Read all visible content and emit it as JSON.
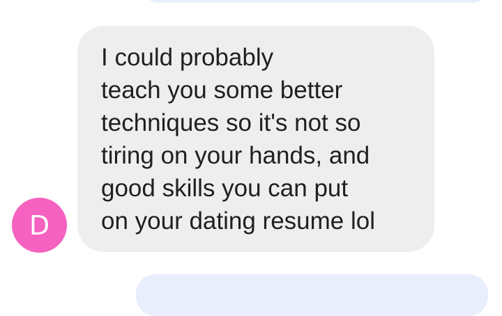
{
  "conversation": {
    "incoming_message": {
      "sender_initial": "D",
      "text": "I could probably\nteach you some better\ntechniques so it's not so\ntiring on your hands, and\ngood skills you can put\non your dating resume lol"
    }
  },
  "colors": {
    "avatar_background": "#f562bf",
    "incoming_bubble": "#eeeeef",
    "outgoing_bubble": "#e8eefc",
    "message_text": "#1f1f1f"
  }
}
